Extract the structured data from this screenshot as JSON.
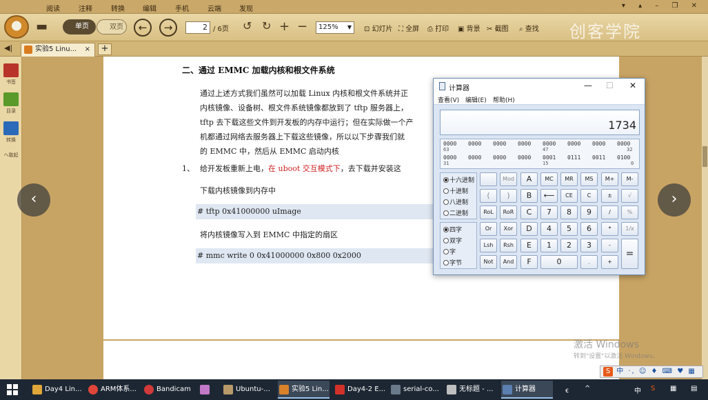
{
  "menubar": {
    "items": [
      "阅读",
      "注释",
      "转换",
      "编辑",
      "手机",
      "云端",
      "发现"
    ],
    "window_controls": "▾ ▴ – ❐ ✕"
  },
  "toolbar": {
    "single_page": "单页",
    "double_page": "双页",
    "current_page": "2",
    "total_pages": "/ 6页",
    "zoom": "125%",
    "slideshow": "幻灯片",
    "fullscreen": "全屏",
    "print": "打印",
    "background": "背景",
    "screenshot": "截图",
    "find": "查找"
  },
  "brand": "创客学院",
  "tabs": [
    {
      "label": "实验5 Linu...",
      "close": "×"
    }
  ],
  "tab_add": "+",
  "sidebar": {
    "back": "◀|",
    "items": [
      {
        "label": "书签",
        "color": "#b8342a"
      },
      {
        "label": "目录",
        "color": "#5a9a2a"
      },
      {
        "label": "转换",
        "color": "#2a6ab8"
      },
      {
        "label": "ヘ敢起",
        "color": ""
      }
    ]
  },
  "document": {
    "heading": "二、通过 EMMC 加载内核和根文件系统",
    "lines": [
      "通过上述方式我们虽然可以加载 Linux 内核和根文件系统并正",
      "内核镜像、设备树、根文件系统镜像都放到了 tftp 服务器上，",
      "tftp 去下载这些文件到开发板的内存中运行；但在实际做一个产",
      "机都通过网络去服务器上下载这些镜像，所以以下步骤我们就",
      "的 EMMC 中，然后从 EMMC 启动内核"
    ],
    "step_num": "1、",
    "step_a": "给开发板重新上电，",
    "step_red": "在 uboot 交互模式下",
    "step_b": "，去下载并安装这",
    "sub1": "下载内核镜像到内存中",
    "code1": "# tftp    0x41000000    uImage",
    "sub2": "将内核镜像写入到 EMMC 中指定的扇区",
    "code2": "# mmc    write    0    0x41000000    0x800    0x2000"
  },
  "nav": {
    "prev": "‹",
    "next": "›"
  },
  "calculator": {
    "title": "计算器",
    "menu": [
      "查看(V)",
      "编辑(E)",
      "帮助(H)"
    ],
    "display": "1734",
    "bits_row1": [
      "0000",
      "0000",
      "0000",
      "0000",
      "0000",
      "0000",
      "0000",
      "0000"
    ],
    "bits_row1_marks": [
      "63",
      "47",
      "32"
    ],
    "bits_row2": [
      "0000",
      "0000",
      "0000",
      "0000",
      "0001",
      "0111",
      "0011",
      "0100"
    ],
    "bits_row2_marks": [
      "31",
      "15",
      "0"
    ],
    "radix": [
      "十六进制",
      "十进制",
      "八进制",
      "二进制"
    ],
    "radix_selected": 0,
    "word": [
      "四字",
      "双字",
      "字",
      "字节"
    ],
    "word_selected": 0,
    "buttons": {
      "row1": [
        "",
        "Mod",
        "A",
        "MC",
        "MR",
        "MS",
        "M+",
        "M-"
      ],
      "row2": [
        "(",
        ")",
        "B",
        "⟵",
        "CE",
        "C",
        "±",
        "√"
      ],
      "row3": [
        "RoL",
        "RoR",
        "C",
        "7",
        "8",
        "9",
        "/",
        "%"
      ],
      "row4": [
        "Or",
        "Xor",
        "D",
        "4",
        "5",
        "6",
        "*",
        "1/x"
      ],
      "row5": [
        "Lsh",
        "Rsh",
        "E",
        "1",
        "2",
        "3",
        "-",
        "="
      ],
      "row6": [
        "Not",
        "And",
        "F",
        "0",
        ".",
        "+"
      ]
    },
    "controls": {
      "minimize": "—",
      "maximize": "☐",
      "close": "✕"
    }
  },
  "watermark": {
    "title": "激活 Windows",
    "hint": "转到\"设置\"以激活 Windows。"
  },
  "ime": {
    "logo": "S",
    "text": "中 ·, ☺ ♦ ⌨ ♥ ▦"
  },
  "taskbar": {
    "items": [
      {
        "label": "Day4 Lin...",
        "color": "#e0a63a"
      },
      {
        "label": "ARM体系...",
        "color": "#e0453a"
      },
      {
        "label": "Bandicam",
        "color": "#d23a3a"
      },
      {
        "label": "",
        "color": "#c27ac8"
      },
      {
        "label": "Ubuntu-...",
        "color": "#b89a6a"
      },
      {
        "label": "实验5 Lin...",
        "color": "#d9822a"
      },
      {
        "label": "Day4-2 E...",
        "color": "#d2312a"
      },
      {
        "label": "serial-co...",
        "color": "#6a7a8a"
      },
      {
        "label": "无标题 - ...",
        "color": "#bfbfbf"
      },
      {
        "label": "计算器",
        "color": "#5a7fb0"
      }
    ],
    "tray": {
      "person": "ꞓ",
      "chevron": "^",
      "ime": "中",
      "s": "S",
      "grid": "▦",
      "notify": "▤"
    }
  },
  "overlay": {
    "zoom_in": "⊕",
    "zoom_out": "⊖",
    "rotate": "⟲"
  }
}
